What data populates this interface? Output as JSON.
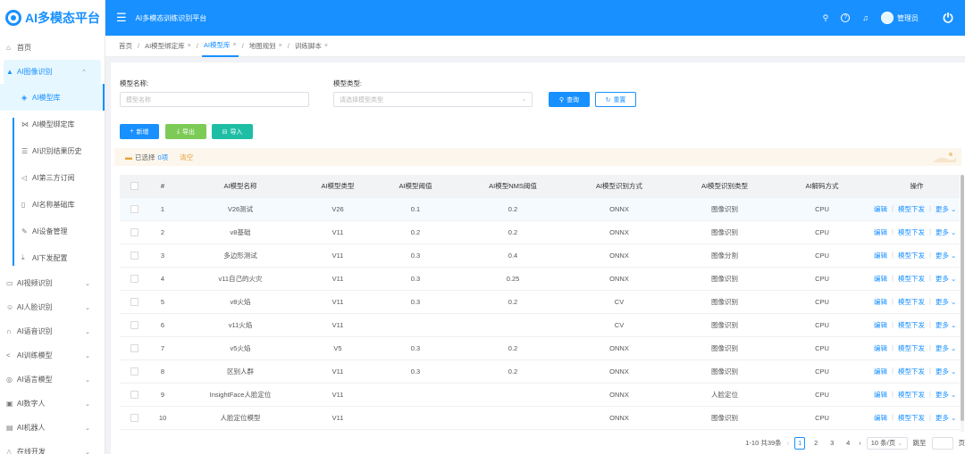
{
  "app": {
    "logo_text": "AI多模态平台",
    "title": "AI多模态训练识别平台",
    "user_name": "管理员",
    "menu_icon": "menu-fold-icon",
    "header_icons": [
      "search-icon",
      "help-icon",
      "bell-icon",
      "avatar-icon",
      "power-icon"
    ]
  },
  "sidebar": {
    "home": "首页",
    "open_group": "AI图像识别",
    "sub_items": [
      {
        "label": "AI模型库",
        "icon": "cube-icon"
      },
      {
        "label": "AI模型绑定库",
        "icon": "bind-icon"
      },
      {
        "label": "AI识别结果历史",
        "icon": "list-icon"
      },
      {
        "label": "AI第三方订阅",
        "icon": "speaker-icon"
      },
      {
        "label": "AI名称基础库",
        "icon": "doc-icon"
      },
      {
        "label": "AI设备管理",
        "icon": "wrench-icon"
      },
      {
        "label": "AI下发配置",
        "icon": "download-icon"
      }
    ],
    "groups": [
      {
        "label": "AI视频识别",
        "icon": "video-icon"
      },
      {
        "label": "AI人脸识别",
        "icon": "face-icon"
      },
      {
        "label": "AI语音识别",
        "icon": "headset-icon"
      },
      {
        "label": "AI训练模型",
        "icon": "share-icon"
      },
      {
        "label": "AI语言模型",
        "icon": "chat-icon"
      },
      {
        "label": "AI数字人",
        "icon": "monitor-icon"
      },
      {
        "label": "AI机器人",
        "icon": "robot-icon"
      },
      {
        "label": "在线开发",
        "icon": "code-icon"
      }
    ]
  },
  "breadcrumb": {
    "home": "首页",
    "tabs": [
      {
        "label": "AI模型绑定库",
        "active": false
      },
      {
        "label": "AI模型库",
        "active": true
      },
      {
        "label": "地图规划",
        "active": false
      },
      {
        "label": "训练脚本",
        "active": false
      }
    ]
  },
  "filters": {
    "name_label": "模型名称:",
    "name_placeholder": "模型名称",
    "type_label": "模型类型:",
    "type_placeholder": "请选择模型类型",
    "search_button": "查询",
    "reset_button": "重置"
  },
  "toolbar": {
    "add": "新增",
    "export": "导出",
    "import": "导入"
  },
  "selection": {
    "prefix": "已选择",
    "count": "0项",
    "clear": "清空"
  },
  "table": {
    "headers": [
      "#",
      "AI模型名称",
      "AI模型类型",
      "AI模型阈值",
      "AI模型NMS阈值",
      "AI模型识别方式",
      "AI模型识别类型",
      "AI解码方式",
      "操作"
    ],
    "rows": [
      {
        "idx": "1",
        "name": "V26测试",
        "type": "V26",
        "thr": "0.1",
        "nms": "0.2",
        "mode": "ONNX",
        "kind": "图像识别",
        "dec": "CPU"
      },
      {
        "idx": "2",
        "name": "v8基础",
        "type": "V11",
        "thr": "0.2",
        "nms": "0.2",
        "mode": "ONNX",
        "kind": "图像识别",
        "dec": "CPU"
      },
      {
        "idx": "3",
        "name": "多边形测试",
        "type": "V11",
        "thr": "0.3",
        "nms": "0.4",
        "mode": "ONNX",
        "kind": "图像分割",
        "dec": "CPU"
      },
      {
        "idx": "4",
        "name": "v11自己的火灾",
        "type": "V11",
        "thr": "0.3",
        "nms": "0.25",
        "mode": "ONNX",
        "kind": "图像识别",
        "dec": "CPU"
      },
      {
        "idx": "5",
        "name": "v8火焰",
        "type": "V11",
        "thr": "0.3",
        "nms": "0.2",
        "mode": "CV",
        "kind": "图像识别",
        "dec": "CPU"
      },
      {
        "idx": "6",
        "name": "v11火焰",
        "type": "V11",
        "thr": "",
        "nms": "",
        "mode": "CV",
        "kind": "图像识别",
        "dec": "CPU"
      },
      {
        "idx": "7",
        "name": "v5火焰",
        "type": "V5",
        "thr": "0.3",
        "nms": "0.2",
        "mode": "ONNX",
        "kind": "图像识别",
        "dec": "CPU"
      },
      {
        "idx": "8",
        "name": "区别人群",
        "type": "V11",
        "thr": "0.3",
        "nms": "0.2",
        "mode": "ONNX",
        "kind": "图像识别",
        "dec": "CPU"
      },
      {
        "idx": "9",
        "name": "InsightFace人脸定位",
        "type": "V11",
        "thr": "",
        "nms": "",
        "mode": "ONNX",
        "kind": "人脸定位",
        "dec": "CPU"
      },
      {
        "idx": "10",
        "name": "人脸定位模型",
        "type": "V11",
        "thr": "",
        "nms": "",
        "mode": "ONNX",
        "kind": "图像识别",
        "dec": "CPU"
      }
    ],
    "actions": {
      "edit": "编辑",
      "deploy": "模型下发",
      "more": "更多"
    }
  },
  "pagination": {
    "summary": "1-10 共39条",
    "pages": [
      "1",
      "2",
      "3",
      "4"
    ],
    "page_size": "10 条/页",
    "jump_label": "跳至",
    "page_unit": "页"
  }
}
